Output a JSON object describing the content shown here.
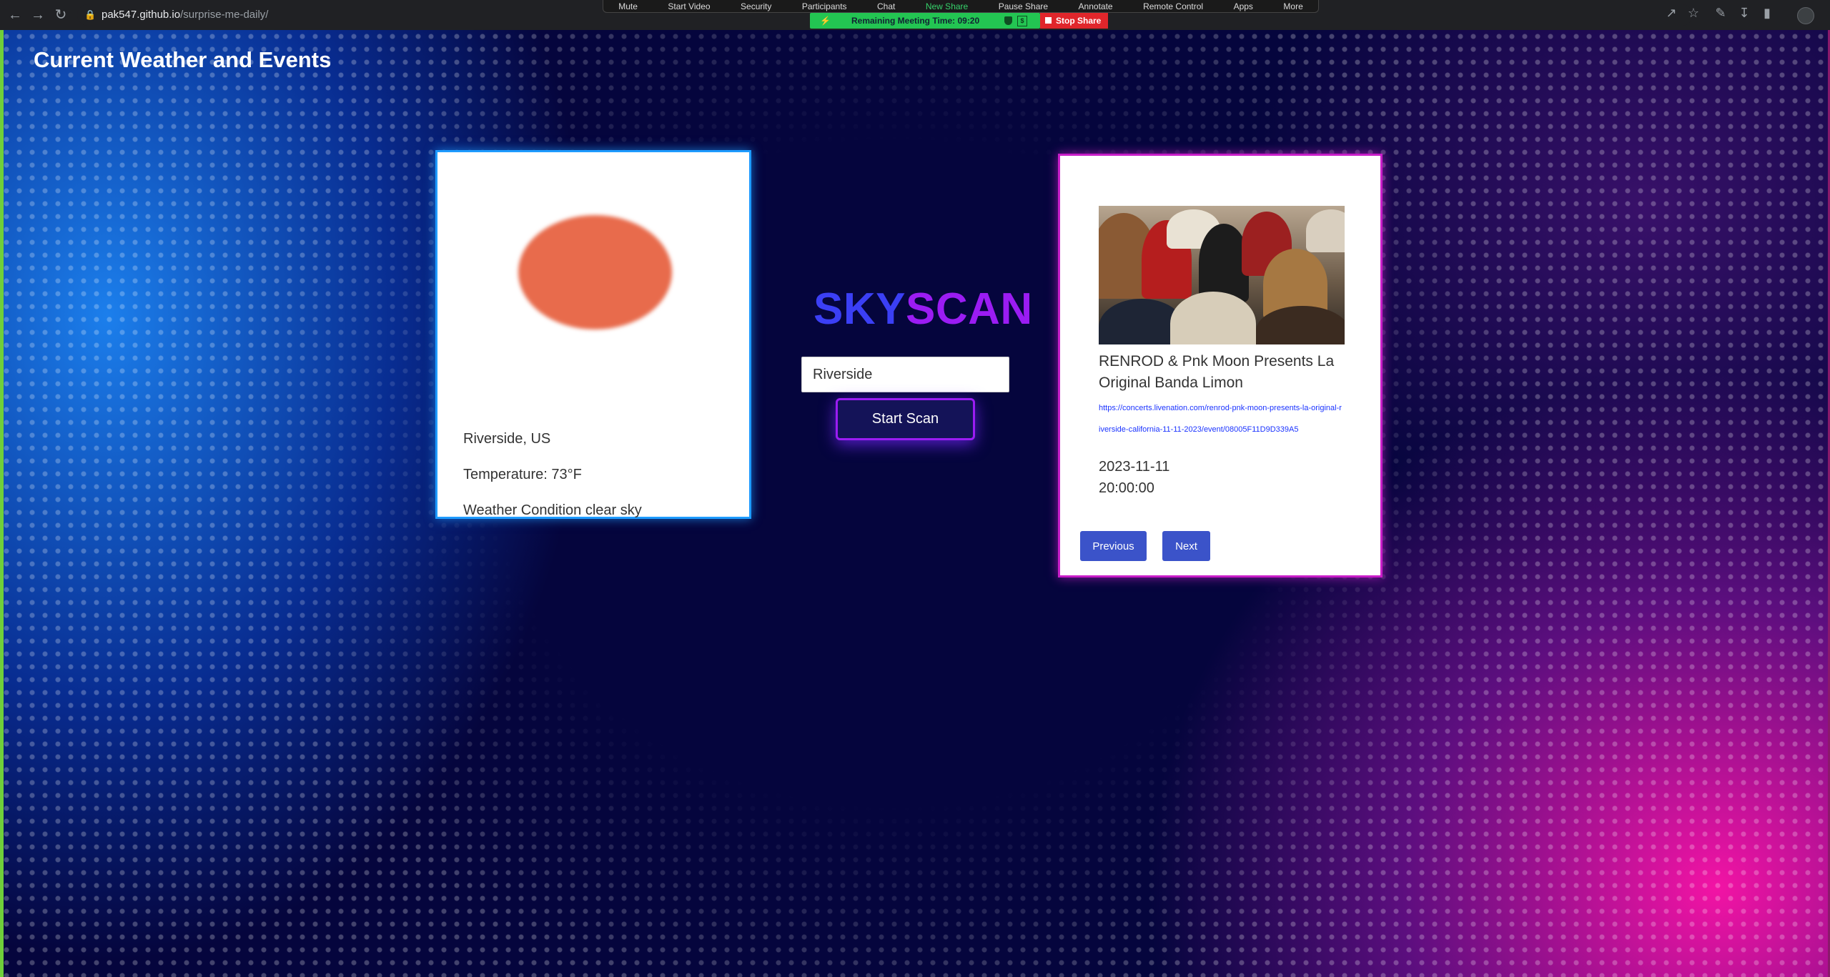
{
  "browser": {
    "url_host": "pak547.github.io",
    "url_path": "/surprise-me-daily/"
  },
  "zoom_toolbar": {
    "items": [
      "Mute",
      "Start Video",
      "Security",
      "Participants",
      "Chat",
      "New Share",
      "Pause Share",
      "Annotate",
      "Remote Control",
      "Apps",
      "More"
    ],
    "meeting_time": "Remaining Meeting Time: 09:20",
    "stop_share": "Stop Share"
  },
  "page": {
    "title": "Current Weather and Events"
  },
  "weather": {
    "location": "Riverside, US",
    "temperature": "Temperature: 73°F",
    "condition": "Weather Condition clear sky",
    "icon": "sun-icon",
    "icon_color": "#e86b4c"
  },
  "search": {
    "logo_part1": "SKY",
    "logo_part2": "SCAN",
    "value": "Riverside",
    "button_label": "Start Scan"
  },
  "event": {
    "title": "RENROD & Pnk Moon Presents La Original Banda Limon",
    "link": "https://concerts.livenation.com/renrod-pnk-moon-presents-la-original-riverside-california-11-11-2023/event/08005F11D9D339A5",
    "date": "2023-11-11",
    "time": "20:00:00",
    "previous_label": "Previous",
    "next_label": "Next"
  },
  "colors": {
    "accent_blue": "#3b3ff5",
    "accent_purple": "#9b1cf3",
    "button_blue": "#3b53c9"
  }
}
